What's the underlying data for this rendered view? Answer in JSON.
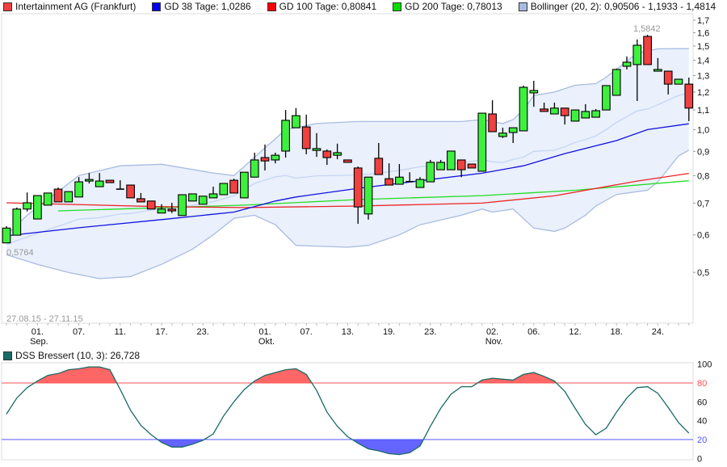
{
  "legend": {
    "main": {
      "label": "Intertainment AG (Frankfurt)",
      "color": "#f04040"
    },
    "gd38": {
      "label": "GD 38 Tage: 1,0286",
      "color": "#0000ee"
    },
    "gd100": {
      "label": "GD 100 Tage: 0,80841",
      "color": "#ff0000"
    },
    "gd200": {
      "label": "GD 200 Tage: 0,78013",
      "color": "#00dd00"
    },
    "bollinger": {
      "label": "Bollinger (20, 2): 0,90506 - 1,1933 - 1,4814",
      "color": "#a8bce0"
    },
    "dss": {
      "label": "DSS Bressert (10, 3): 26,728",
      "color": "#1a6a66"
    }
  },
  "range_label": "27.08.15 - 27.11.15",
  "low_label": "0,5764",
  "high_label": "1,5842",
  "chart_data": [
    {
      "type": "candlestick",
      "title": "Intertainment AG (Frankfurt)",
      "yscale": "log",
      "ylim": [
        0.45,
        1.75
      ],
      "y_ticks": [
        {
          "v": 1.7,
          "t": "1,7"
        },
        {
          "v": 1.6,
          "t": "1,6"
        },
        {
          "v": 1.5,
          "t": "1,5"
        },
        {
          "v": 1.4,
          "t": "1,4"
        },
        {
          "v": 1.3,
          "t": "1,3"
        },
        {
          "v": 1.2,
          "t": "1,2"
        },
        {
          "v": 1.1,
          "t": "1,1"
        },
        {
          "v": 1.0,
          "t": "1,0"
        },
        {
          "v": 0.9,
          "t": "0,9"
        },
        {
          "v": 0.8,
          "t": "0,8"
        },
        {
          "v": 0.7,
          "t": "0,7"
        },
        {
          "v": 0.6,
          "t": "0,6"
        },
        {
          "v": 0.5,
          "t": "0,5"
        }
      ],
      "x_ticks": [
        {
          "i": 3,
          "t": "01.",
          "m": "Sep."
        },
        {
          "i": 7,
          "t": "07."
        },
        {
          "i": 11,
          "t": "11."
        },
        {
          "i": 15,
          "t": "17."
        },
        {
          "i": 19,
          "t": "23."
        },
        {
          "i": 25,
          "t": "01.",
          "m": "Okt."
        },
        {
          "i": 29,
          "t": "07."
        },
        {
          "i": 33,
          "t": "13."
        },
        {
          "i": 37,
          "t": "19."
        },
        {
          "i": 41,
          "t": "23."
        },
        {
          "i": 47,
          "t": "02.",
          "m": "Nov."
        },
        {
          "i": 51,
          "t": "06."
        },
        {
          "i": 55,
          "t": "12."
        },
        {
          "i": 59,
          "t": "18."
        },
        {
          "i": 63,
          "t": "24."
        }
      ],
      "ohlc": [
        [
          0.577,
          0.626,
          0.5764,
          0.62
        ],
        [
          0.599,
          0.685,
          0.599,
          0.68
        ],
        [
          0.68,
          0.737,
          0.672,
          0.701
        ],
        [
          0.648,
          0.726,
          0.648,
          0.726
        ],
        [
          0.693,
          0.735,
          0.693,
          0.735
        ],
        [
          0.749,
          0.755,
          0.704,
          0.704
        ],
        [
          0.704,
          0.74,
          0.704,
          0.74
        ],
        [
          0.721,
          0.794,
          0.721,
          0.776
        ],
        [
          0.779,
          0.81,
          0.77,
          0.785
        ],
        [
          0.758,
          0.81,
          0.758,
          0.779
        ],
        [
          0.782,
          0.782,
          0.773,
          0.773
        ],
        [
          0.749,
          0.782,
          0.748,
          0.748
        ],
        [
          0.764,
          0.764,
          0.718,
          0.718
        ],
        [
          0.715,
          0.735,
          0.704,
          0.704
        ],
        [
          0.707,
          0.707,
          0.68,
          0.68
        ],
        [
          0.667,
          0.696,
          0.667,
          0.68
        ],
        [
          0.68,
          0.701,
          0.667,
          0.674
        ],
        [
          0.659,
          0.729,
          0.659,
          0.729
        ],
        [
          0.707,
          0.732,
          0.707,
          0.732
        ],
        [
          0.696,
          0.724,
          0.696,
          0.724
        ],
        [
          0.718,
          0.758,
          0.718,
          0.732
        ],
        [
          0.729,
          0.77,
          0.729,
          0.77
        ],
        [
          0.782,
          0.788,
          0.735,
          0.735
        ],
        [
          0.718,
          0.813,
          0.718,
          0.813
        ],
        [
          0.794,
          0.894,
          0.794,
          0.863
        ],
        [
          0.873,
          0.93,
          0.82,
          0.859
        ],
        [
          0.863,
          0.894,
          0.849,
          0.883
        ],
        [
          0.901,
          1.1,
          0.873,
          1.046
        ],
        [
          1.009,
          1.11,
          1.009,
          1.07
        ],
        [
          1.013,
          1.075,
          0.887,
          0.912
        ],
        [
          0.904,
          0.983,
          0.876,
          0.912
        ],
        [
          0.901,
          0.908,
          0.843,
          0.873
        ],
        [
          0.883,
          0.934,
          0.866,
          0.894
        ],
        [
          0.863,
          0.863,
          0.853,
          0.853
        ],
        [
          0.83,
          0.836,
          0.633,
          0.687
        ],
        [
          0.664,
          0.794,
          0.646,
          0.794
        ],
        [
          0.87,
          0.937,
          0.804,
          0.804
        ],
        [
          0.788,
          0.849,
          0.764,
          0.764
        ],
        [
          0.767,
          0.846,
          0.767,
          0.794
        ],
        [
          0.776,
          0.813,
          0.776,
          0.777
        ],
        [
          0.755,
          0.794,
          0.755,
          0.785
        ],
        [
          0.776,
          0.863,
          0.776,
          0.853
        ],
        [
          0.823,
          0.863,
          0.823,
          0.853
        ],
        [
          0.823,
          0.901,
          0.823,
          0.901
        ],
        [
          0.863,
          0.863,
          0.794,
          0.823
        ],
        [
          0.846,
          0.846,
          0.83,
          0.83
        ],
        [
          0.817,
          1.083,
          0.817,
          1.083
        ],
        [
          1.079,
          1.153,
          0.99,
          0.99
        ],
        [
          0.967,
          1.009,
          0.96,
          0.983
        ],
        [
          0.986,
          1.009,
          0.937,
          1.009
        ],
        [
          0.994,
          1.238,
          0.994,
          1.228
        ],
        [
          1.195,
          1.267,
          1.117,
          1.209
        ],
        [
          1.105,
          1.14,
          1.092,
          1.092
        ],
        [
          1.079,
          1.14,
          1.079,
          1.11
        ],
        [
          1.11,
          1.11,
          1.025,
          1.07
        ],
        [
          1.042,
          1.1,
          1.042,
          1.1
        ],
        [
          1.058,
          1.131,
          1.058,
          1.092
        ],
        [
          1.062,
          1.105,
          1.062,
          1.096
        ],
        [
          1.1,
          1.238,
          1.1,
          1.238
        ],
        [
          1.181,
          1.344,
          1.181,
          1.339
        ],
        [
          1.36,
          1.426,
          1.339,
          1.387
        ],
        [
          1.371,
          1.549,
          1.149,
          1.506
        ],
        [
          1.572,
          1.5842,
          1.371,
          1.371
        ],
        [
          1.328,
          1.415,
          1.328,
          1.339
        ],
        [
          1.328,
          1.328,
          1.186,
          1.247
        ],
        [
          1.247,
          1.277,
          1.247,
          1.277
        ],
        [
          1.247,
          1.287,
          1.042,
          1.11
        ]
      ],
      "gd38": [
        [
          0,
          0.597
        ],
        [
          7,
          0.621
        ],
        [
          15,
          0.646
        ],
        [
          22,
          0.67
        ],
        [
          26,
          0.707
        ],
        [
          28,
          0.721
        ],
        [
          34,
          0.752
        ],
        [
          46,
          0.809
        ],
        [
          50,
          0.839
        ],
        [
          54,
          0.89
        ],
        [
          59,
          0.948
        ],
        [
          62,
          1.0
        ],
        [
          66,
          1.0286
        ]
      ],
      "gd100": [
        [
          0,
          0.701
        ],
        [
          15,
          0.688
        ],
        [
          23,
          0.685
        ],
        [
          34,
          0.69
        ],
        [
          46,
          0.7
        ],
        [
          53,
          0.725
        ],
        [
          61,
          0.779
        ],
        [
          66,
          0.80841
        ]
      ],
      "gd200": [
        [
          5,
          0.674
        ],
        [
          23,
          0.693
        ],
        [
          34,
          0.712
        ],
        [
          46,
          0.726
        ],
        [
          55,
          0.745
        ],
        [
          66,
          0.78013
        ]
      ],
      "boll_upper": [
        [
          0,
          0.6
        ],
        [
          2,
          0.66
        ],
        [
          7,
          0.8
        ],
        [
          11,
          0.839
        ],
        [
          15,
          0.845
        ],
        [
          20,
          0.81
        ],
        [
          22,
          0.8
        ],
        [
          27,
          1.0
        ],
        [
          30,
          1.03
        ],
        [
          34,
          1.04
        ],
        [
          44,
          1.04
        ],
        [
          46,
          1.05
        ],
        [
          48,
          1.03
        ],
        [
          49,
          1.05
        ],
        [
          50,
          1.1
        ],
        [
          51,
          1.18
        ],
        [
          53,
          1.2
        ],
        [
          55,
          1.24
        ],
        [
          57,
          1.25
        ],
        [
          58,
          1.29
        ],
        [
          59,
          1.34
        ],
        [
          61,
          1.45
        ],
        [
          63,
          1.48
        ],
        [
          66,
          1.4814
        ]
      ],
      "boll_lower": [
        [
          0,
          0.545
        ],
        [
          3,
          0.52
        ],
        [
          6,
          0.5
        ],
        [
          9,
          0.485
        ],
        [
          12,
          0.49
        ],
        [
          15,
          0.52
        ],
        [
          18,
          0.56
        ],
        [
          20,
          0.6
        ],
        [
          22,
          0.65
        ],
        [
          24,
          0.66
        ],
        [
          26,
          0.63
        ],
        [
          28,
          0.57
        ],
        [
          33,
          0.565
        ],
        [
          35,
          0.57
        ],
        [
          38,
          0.6
        ],
        [
          40,
          0.63
        ],
        [
          44,
          0.66
        ],
        [
          46,
          0.68
        ],
        [
          47,
          0.67
        ],
        [
          49,
          0.68
        ],
        [
          51,
          0.62
        ],
        [
          53,
          0.61
        ],
        [
          54,
          0.62
        ],
        [
          56,
          0.66
        ],
        [
          57,
          0.69
        ],
        [
          59,
          0.73
        ],
        [
          61,
          0.74
        ],
        [
          62,
          0.745
        ],
        [
          63,
          0.776
        ],
        [
          65,
          0.88
        ],
        [
          66,
          0.90506
        ]
      ]
    },
    {
      "type": "line",
      "title": "DSS Bressert (10, 3)",
      "ylim": [
        0,
        100
      ],
      "y_ticks": [
        {
          "v": 100,
          "t": "100"
        },
        {
          "v": 80,
          "t": "80"
        },
        {
          "v": 60,
          "t": "60"
        },
        {
          "v": 40,
          "t": "40"
        },
        {
          "v": 20,
          "t": "20"
        },
        {
          "v": 0,
          "t": "0"
        }
      ],
      "upper_level": 80,
      "lower_level": 20,
      "values": [
        47,
        64,
        75,
        82,
        88,
        90,
        94,
        95,
        97,
        97,
        94,
        73,
        51,
        35,
        25,
        17,
        12,
        12,
        15,
        19,
        26,
        45,
        60,
        73,
        82,
        88,
        91,
        94,
        95,
        89,
        72,
        49,
        34,
        23,
        16,
        10,
        8,
        5,
        4,
        6,
        13,
        34,
        53,
        68,
        76,
        76,
        83,
        85,
        84,
        83,
        89,
        91,
        87,
        82,
        71,
        53,
        36,
        25,
        32,
        49,
        64,
        75,
        76,
        69,
        54,
        38,
        26.728
      ]
    }
  ]
}
